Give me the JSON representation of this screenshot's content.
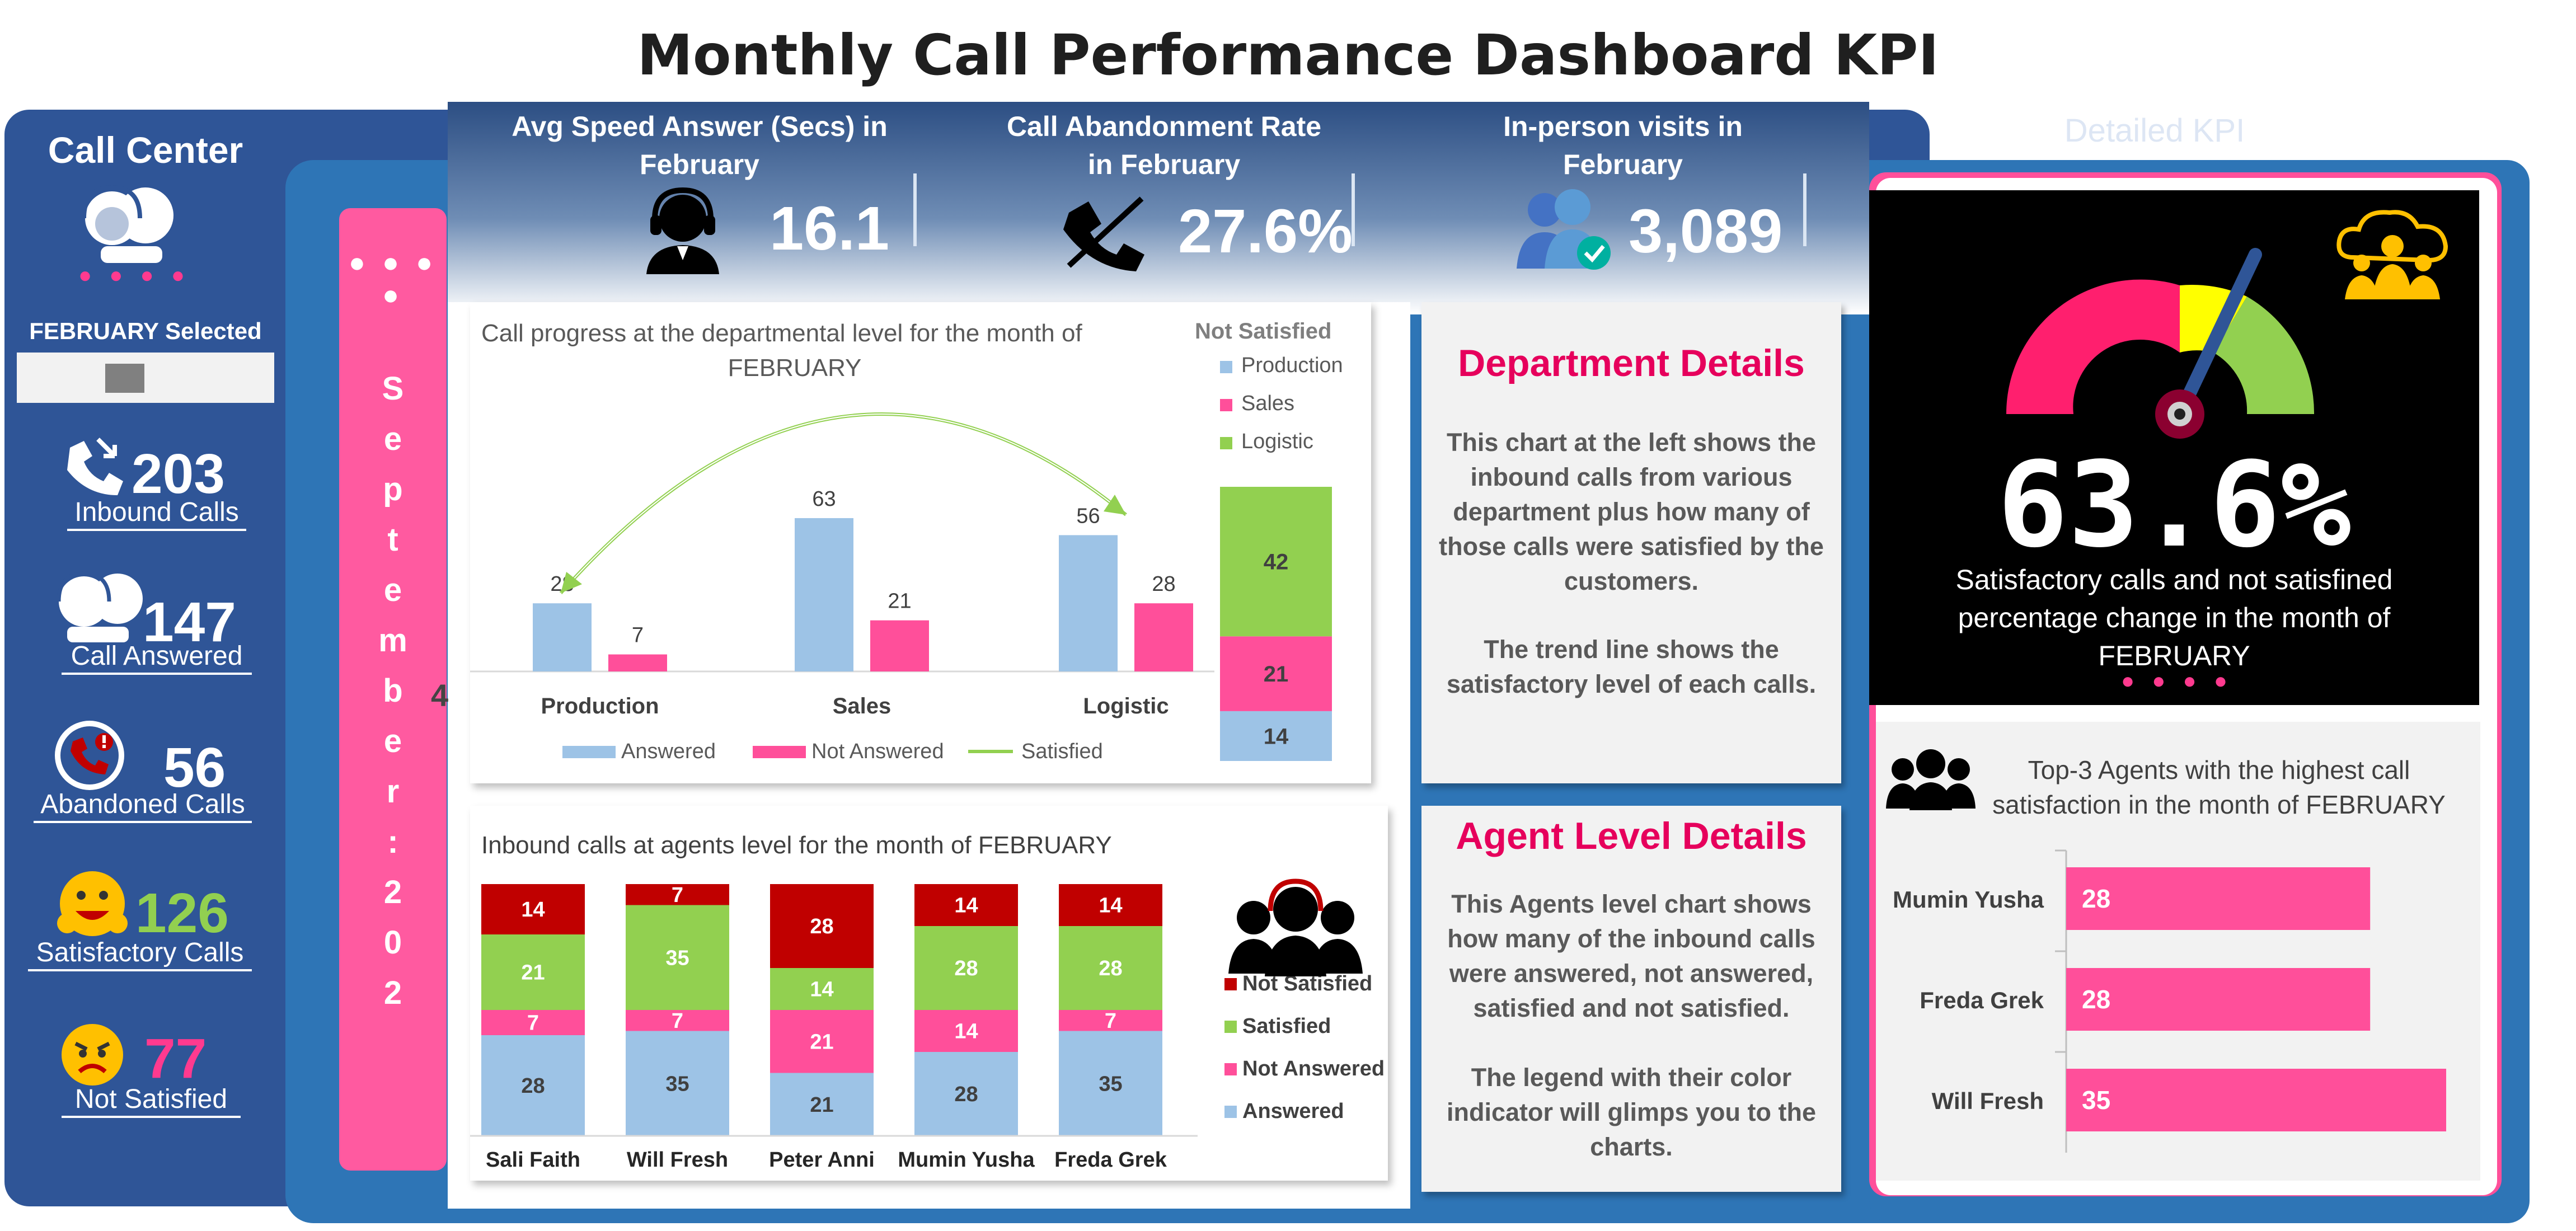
{
  "title": "Monthly Call Performance Dashboard KPI",
  "sidebar": {
    "title": "Call Center",
    "selected_label": "FEBRUARY Selected",
    "stats": [
      {
        "value": "203",
        "label": "Inbound Calls",
        "icon": "phone-incoming-icon",
        "color": "#ffffff"
      },
      {
        "value": "147",
        "label": "Call Answered",
        "icon": "headset-agents-icon",
        "color": "#ffffff"
      },
      {
        "value": "56",
        "label": "Abandoned Calls",
        "icon": "phone-alert-icon",
        "color": "#ffffff"
      },
      {
        "value": "126",
        "label": "Satisfactory Calls",
        "icon": "happy-face-icon",
        "color": "#92d050"
      },
      {
        "value": "77",
        "label": "Not Satisfied",
        "icon": "angry-face-icon",
        "color": "#ff3a8f"
      }
    ]
  },
  "slicer": {
    "letters": [
      "S",
      "e",
      "p",
      "t",
      "e",
      "m",
      "b",
      "e",
      "r",
      ":",
      "2",
      "0",
      "2"
    ],
    "extra": "4"
  },
  "kpis": [
    {
      "header": "Avg Speed Answer (Secs)  in February",
      "value": "16.1",
      "icon": "agent-headset-icon"
    },
    {
      "header": "Call Abandonment Rate in February",
      "value": "27.6%",
      "icon": "phone-slash-icon"
    },
    {
      "header": "In-person visits in February",
      "value": "3,089",
      "icon": "verified-users-icon"
    }
  ],
  "detailed_kpi": {
    "title": "Detailed KPI",
    "gauge_value": "63.6%",
    "gauge_percent": 63.6,
    "gauge_caption": "Satisfactory calls and not satisfined percentage change in the month of FEBRUARY",
    "gauge_colors": [
      "#ff1f6e",
      "#ffff00",
      "#92d050"
    ]
  },
  "department_card": {
    "title": "Department Details",
    "body1": "This chart at the left shows the inbound calls from various department plus how many of those calls were satisfied by the customers.",
    "body2": "The trend line shows the satisfactory level of each calls."
  },
  "agent_card": {
    "title": "Agent Level Details",
    "body1": "This Agents level chart shows how many of the inbound calls were answered, not answered, satisfied and not satisfied.",
    "body2": "The legend with their color indicator will glimps you to the charts."
  },
  "top3": {
    "title": "Top-3 Agents with the highest call satisfaction in the month of FEBRUARY"
  },
  "chart_data": [
    {
      "type": "bar",
      "title": "Call progress at the departmental level for the month of FEBRUARY",
      "categories": [
        "Production",
        "Sales",
        "Logistic"
      ],
      "series": [
        {
          "name": "Answered",
          "values": [
            28,
            63,
            56
          ],
          "color": "#9dc3e6"
        },
        {
          "name": "Not Answered",
          "values": [
            7,
            21,
            28
          ],
          "color": "#ff4f9a"
        },
        {
          "name": "Satisfied",
          "values": [
            28,
            63,
            56
          ],
          "color": "#92d050"
        }
      ],
      "legend": "bottom"
    },
    {
      "type": "bar",
      "title": "Not Satisfied",
      "stacked": true,
      "categories": [
        ""
      ],
      "series": [
        {
          "name": "Production",
          "values": [
            14
          ],
          "color": "#9dc3e6"
        },
        {
          "name": "Sales",
          "values": [
            21
          ],
          "color": "#ff4f9a"
        },
        {
          "name": "Logistic",
          "values": [
            42
          ],
          "color": "#92d050"
        }
      ],
      "legend": "top"
    },
    {
      "type": "bar",
      "title": "Inbound calls at agents level for the month of  FEBRUARY",
      "stacked": true,
      "categories": [
        "Sali Faith",
        "Will Fresh",
        "Peter Anni",
        "Mumin Yusha",
        "Freda Grek"
      ],
      "series": [
        {
          "name": "Answered",
          "values": [
            28,
            35,
            21,
            28,
            35
          ],
          "color": "#9dc3e6"
        },
        {
          "name": "Not Answered",
          "values": [
            7,
            7,
            21,
            14,
            7
          ],
          "color": "#ff4f9a"
        },
        {
          "name": "Satisfied",
          "values": [
            21,
            35,
            14,
            28,
            28
          ],
          "color": "#92d050"
        },
        {
          "name": "Not Satisfied",
          "values": [
            14,
            7,
            28,
            14,
            14
          ],
          "color": "#c00000"
        }
      ],
      "legend": "right"
    },
    {
      "type": "bar",
      "orientation": "horizontal",
      "title": "Top-3 Agents with the highest call satisfaction in the month of FEBRUARY",
      "categories": [
        "Mumin Yusha",
        "Freda Grek",
        "Will Fresh"
      ],
      "values": [
        28,
        28,
        35
      ],
      "color": "#ff4f9a"
    }
  ]
}
